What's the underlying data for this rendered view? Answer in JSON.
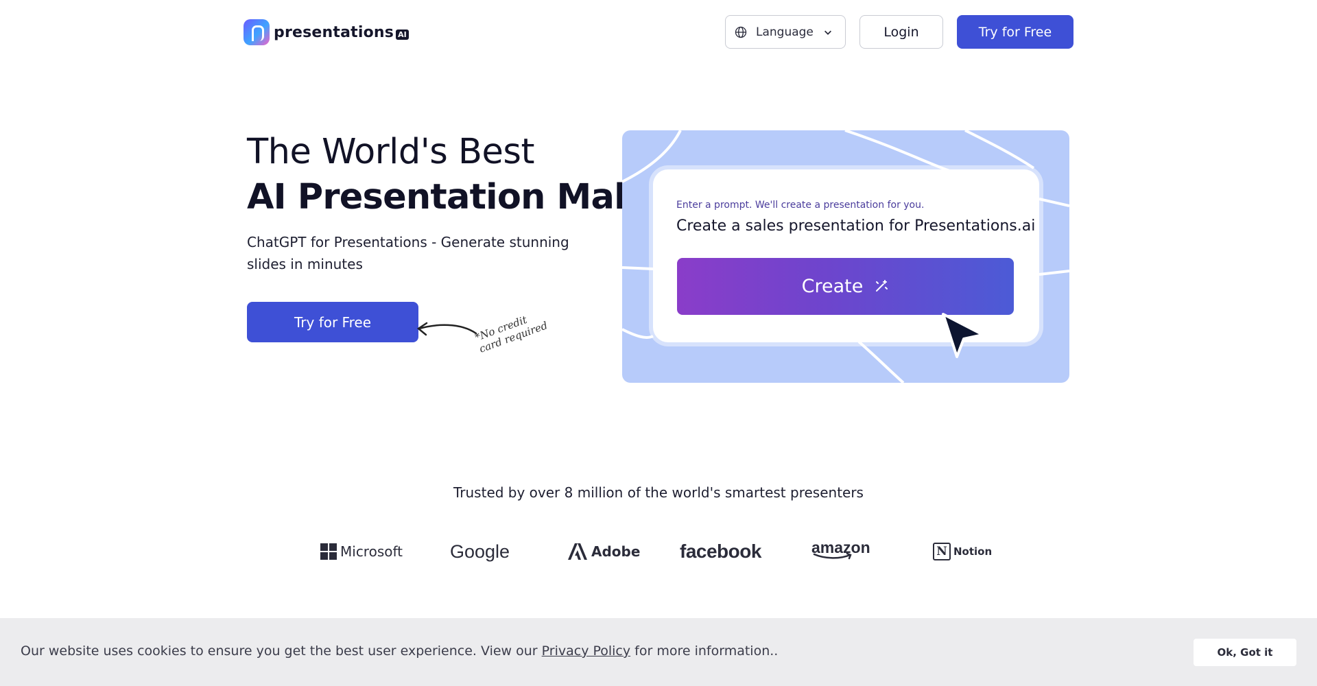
{
  "header": {
    "brand_name": "presentations",
    "brand_badge": "AI",
    "language_label": "Language",
    "login_label": "Login",
    "try_free_label": "Try for Free"
  },
  "hero": {
    "title_line1": "The World's Best",
    "title_line2": "AI Presentation Maker",
    "subtitle": "ChatGPT for Presentations - Generate stunning slides in minutes",
    "cta_label": "Try for Free",
    "note_line1": "*No credit",
    "note_line2": "card required"
  },
  "illustration": {
    "prompt_hint": "Enter a prompt. We'll create a presentation for you.",
    "prompt_text": "Create a sales presentation for Presentations.ai",
    "create_label": "Create"
  },
  "trusted": {
    "heading": "Trusted by over 8 million of the world's smartest presenters",
    "brands": [
      "Microsoft",
      "Google",
      "Adobe",
      "facebook",
      "amazon",
      "Notion"
    ]
  },
  "cookie": {
    "text_before": "Our website uses cookies to ensure you get the best user experience. View our ",
    "link_label": "Privacy Policy",
    "text_after": " for more information..",
    "accept_label": "Ok, Got it"
  },
  "colors": {
    "primary": "#3e50d6",
    "illustration_bg": "#b7cbfa",
    "create_gradient_start": "#8a3dc9",
    "create_gradient_end": "#4c5bd6",
    "cookie_bg": "#ececee"
  },
  "icons": [
    "presentations-logo-icon",
    "globe-icon",
    "chevron-down-icon",
    "magic-wand-icon",
    "cursor-pointer-icon",
    "curved-arrow-icon",
    "microsoft-logo-icon",
    "adobe-logo-icon",
    "notion-logo-icon"
  ]
}
